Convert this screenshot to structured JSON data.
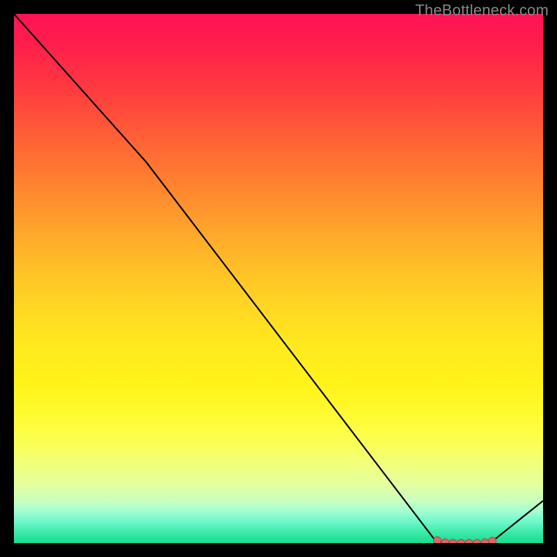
{
  "watermark": "TheBottleneck.com",
  "chart_data": {
    "type": "line",
    "title": "",
    "xlabel": "",
    "ylabel": "",
    "x": [
      0.0,
      0.25,
      0.8,
      0.9,
      1.0
    ],
    "y": [
      1.0,
      0.72,
      0.0,
      0.0,
      0.08
    ],
    "xlim": [
      0,
      1
    ],
    "ylim": [
      0,
      1
    ],
    "markers": {
      "x": [
        0.8,
        0.815,
        0.83,
        0.845,
        0.86,
        0.875,
        0.89,
        0.904
      ],
      "y": [
        0.005,
        0.001,
        0.0,
        0.0,
        0.0,
        0.0,
        0.001,
        0.004
      ]
    },
    "colors": {
      "line": "#000000",
      "marker_fill": "#e06464",
      "marker_stroke": "#b04848"
    }
  }
}
